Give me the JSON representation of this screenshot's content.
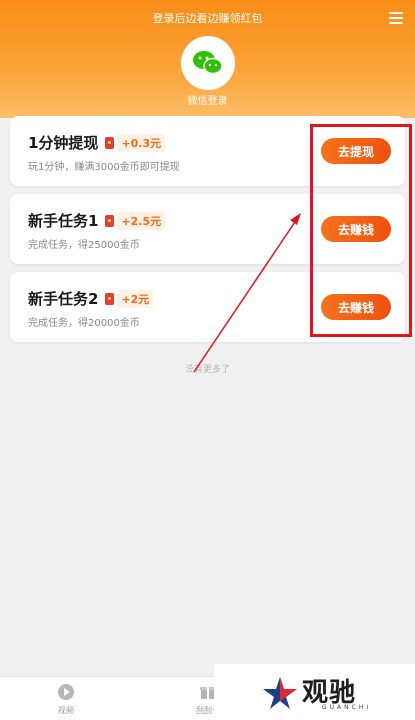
{
  "header": {
    "title": "登录后边看边赚领红包",
    "wechat_label": "微信登录",
    "menu_icon": "menu-icon",
    "wechat_icon": "wechat-icon"
  },
  "tasks": [
    {
      "title": "1分钟提现",
      "reward": "+0.3元",
      "subtitle": "玩1分钟，赚满3000金币即可提现",
      "button": "去提现"
    },
    {
      "title": "新手任务1",
      "reward": "+2.5元",
      "subtitle": "完成任务，得25000金币",
      "button": "去赚钱"
    },
    {
      "title": "新手任务2",
      "reward": "+2元",
      "subtitle": "完成任务，得20000金币",
      "button": "去赚钱"
    }
  ],
  "footer_note": "没有更多了",
  "bottom_nav": [
    {
      "label": "视频",
      "icon": "play-icon"
    },
    {
      "label": "刮刮卡",
      "icon": "gift-icon"
    }
  ],
  "watermark": {
    "text": "观驰",
    "sub": "GUANCHI"
  },
  "colors": {
    "header_orange": "#f98d16",
    "button_orange": "#f0500f",
    "reward_orange": "#f26a1b",
    "annotation_red": "#e5161a"
  }
}
